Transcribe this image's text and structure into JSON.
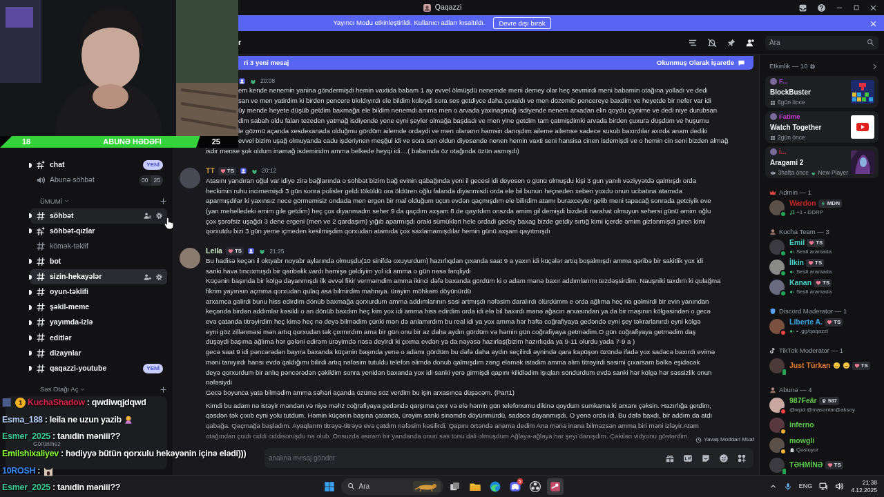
{
  "window": {
    "title": "Qaqazzi"
  },
  "banner": {
    "text": "Yayıncı Modu etkinleştirildi. Kullanıcı adları kısaltıldı.",
    "button": "Devre dışı bırak"
  },
  "goal_bar": {
    "current": "18",
    "label": "ABUNƏ HƏDƏFI",
    "target": "25",
    "level": 0.84
  },
  "sidebar": {
    "items": [
      {
        "kind": "special",
        "name": "chat",
        "unread": true,
        "selected": false,
        "hovered": false,
        "badge": "YENİ"
      },
      {
        "kind": "voice",
        "name": "Abunə söhbət",
        "unread": false,
        "selected": false,
        "hovered": false,
        "counts": [
          "00",
          "25"
        ]
      },
      {
        "kind": "category",
        "name": "ÜMUMİ"
      },
      {
        "kind": "text",
        "name": "söhbət",
        "unread": true,
        "selected": false,
        "hovered": true
      },
      {
        "kind": "special",
        "name": "söhbət-qızlar",
        "unread": true,
        "selected": false,
        "hovered": false
      },
      {
        "kind": "text",
        "name": "kömək-təklif",
        "unread": false,
        "selected": false,
        "hovered": false
      },
      {
        "kind": "text",
        "name": "bot",
        "unread": true,
        "selected": false,
        "hovered": false
      },
      {
        "kind": "text",
        "name": "sizin-hekayələr",
        "unread": true,
        "selected": true,
        "hovered": false
      },
      {
        "kind": "text",
        "name": "oyun-təklifi",
        "unread": true,
        "selected": false,
        "hovered": false
      },
      {
        "kind": "text",
        "name": "şəkil-meme",
        "unread": true,
        "selected": false,
        "hovered": false
      },
      {
        "kind": "text",
        "name": "yayımda-izlə",
        "unread": true,
        "selected": false,
        "hovered": false
      },
      {
        "kind": "text",
        "name": "editlər",
        "unread": true,
        "selected": false,
        "hovered": false
      },
      {
        "kind": "text",
        "name": "dizaynlar",
        "unread": true,
        "selected": false,
        "hovered": false
      },
      {
        "kind": "text",
        "name": "qaqazzi-youtube",
        "unread": true,
        "selected": false,
        "hovered": false,
        "badge": "YENİ"
      },
      {
        "kind": "category",
        "name": "Səs Otağı Aç"
      }
    ],
    "user_status": "Görünmez"
  },
  "channel_header": {
    "name": "r",
    "search_placeholder": "Ara"
  },
  "new_messages": {
    "text": "ri 3 yeni mesaj",
    "action": "Okunmuş Olarak İşaretle"
  },
  "messages": [
    {
      "time": "20:08",
      "lines": [
        "em kende nenemin yanina göndermişdi hemin vaxtida babam 1 ay evvel ölmüşdü nenemde meni demey olar heç sevmirdi meni babamin otağına yolladı ve dedi",
        "san ve men yatirdim ki birden pencere tıkıldıyırdı ele bildim küleydi  sora ses getdiyce daha çoxaldı ve men dözemib pencereye baxdim ve heyetde bir nefer var idi",
        "üy mende heyete düşüb getdim baxmağa ele bildim nenemdi amma men o arvada yaxinaşmağ isdiyende nenem arxadan elin qoydu çiynime ve dedi niye durubsan",
        "dim sabah oldu falan tezeden yatmağ isdiyende yene eyni şeyler olmağa başdadı ve men yine getdim tam çatmişdimki arvada birden çuxura düşdüm ve huşumu",
        "le gözmü açanda xesdexanada olduğmu gördüm ailemde ordaydi ve men olanarın hamsin danışdım aileme ailemse sadece susub baxırdılar axırda anam dediki",
        "evvel bizim uşağ olmuyanda cadu işderiynen meşğul idi ve sora sen oldun diyesende nenen hemin vaxti seni hansisa cinen isdemişdi ve o hemin cin seni bizden almağ",
        "isdir  mense şok oldum inamağ isdemiridm amma belkede heyqi idi....( babamda öz otağında özün asmışdı)"
      ]
    },
    {
      "author": "TT",
      "color": "#c99a3c",
      "tag": "TS",
      "time": "20:12",
      "lines": [
        "Atasını yandıran oğul var idiye zirə bağlarında o söhbət bizim bağ evinin qabağında yeni il gecesi idi deyesen o günü olmuşdu kişi 3 gun yanılı vəziyyətdə qalmışdı orda",
        "heckimin ruhu incimemişdi 3 gün sonra polisler geldi töküldü ora öldüren oğlu falanda diyanmisdi orda ele bil bunun heçneden xeberi yoxdu onun ucbatına atamıda",
        "aparmışdılar ki yaxınsız nece görmemisiz ondada men ergen bir mal olduğum üçün evdən qaçmışdım ele bilirdim atamı buraxceyler gelib meni tapacağ sonrada getciyik eve",
        "(yan mehelledeki əmim gile getdim) heç çox diyanmadm seher 9 da qaçdım axşam 8 de qayıtdım onszda əmim gil demişdi bizdedi narahat olmuyun sehersi günü əmim oğlu",
        "çox şərəfsiz uşağdı 3 dene ergeni (men ve 2 qardaşım) yığıb aparmışdı oraki sümükləri hele ordadi gedey baxag bizde getdiy sırtığ kimi içerde əmim gizlənmişdi giren kimi",
        "qorxutdu bizi 3 gün yeme içmeden kesilmişdim qorxudan atamıda çox saxlamamışdılar  hemin günü axşam qayıtmışdı"
      ]
    },
    {
      "author": "Leila",
      "color": "#cfe8c6",
      "tag": "TS",
      "time": "21:25",
      "lines": [
        "Bu hadisə keçən il oktyabr noyabr aylarında olmuşdu(10 sinifdə oxuyurdum) hazırlıqdan çıxanda saat 9 a yaxın idi küçələr artıq boşalmışdı amma qəribə bir sakitlik yox idi",
        "sanki hava tıncıxmışdı bir qəribəlik vardı həmişə gəldiyim yol idi amma o gün nəsə fərqliydi",
        "Küçənin başında bir kölgə dayanmışdı ilk əvvəl fikir verməmdim amma ikinci dəfə baxanda gördüm ki o adam mənə baxır addımlarımı tezdəşsirdim. Nauşniki taxdım ki qulağma",
        "fikrim yayınsın açmma qorxudan qulaq asa bilmirdim mahnıya. ürəyim möhkəm döyünürdü",
        "arxamca gəlirdi bunu hiss edirdim dönüb baxmağa qorxurdum amma addımlarının səsi artmışdı nəfəsim daralırdı ölürdümm e orda ağlıma heç nə gəlmirdi bir evin yanından",
        "keçəndə birdən addımlar kəsildi o an dönüb baxdım heç kim yox idi amma hiss edirdim orda idi elə bil baxırdı mənə ağacın arxasından ya da bir maşının kölgəsindən o gecə",
        "evə çatanda titrəyirdim heç kimə heç nə deyə bilmədim çünki mən də anlamırdım bu real idi ya yox amma hər həftə coğrafiyaya gedəndə eyni şey təkrarlanırdı eyni kölgə",
        "eyni göz zillənməsi mən artıq qorxudan tək çıxmırdım ama bir gün onu bir az daha aydın gördüm və həmin gün coğrafiyaya getmədim.O gün coğrafiyaya getmədim daş",
        "düşəydi başıma ağlıma hər gələni edirəm ürəyimdə nəsə deyirdi ki çıxma evdən ya da nəyəsə hazırlaş(bizim hazırlıqda ya 9-11 olurdu yada 7-9 a )",
        "gecə saat 9 idi pəncərədən bayıra baxanda küçənin başında yenə o adamı gördüm bu dəfə daha aydın seçilirdi əynində qara kapüşon üzündə ifadə yox sadəcə baxırdı evimə",
        "məni tanıyırdı hansı evdə qaldığımı bilirdi artıq nəfəsim tutuldu telefon əlimdə donub qalmışdım zəng eləmək istədim amma əlim titrəyirdi səsimi çıxarsam bəlkə eşidəcək",
        "deyə qorxurdum bir anlıq pəncərədən çəkildim sonra yenidən baxanda yox idi sanki yerə girmişdi qapını kilidlədim işıqları söndürdüm evdə sanki hər kölgə hər səssizlik onun",
        "nəfəsiydi",
        "Gecə boyunca yata bilmədim amma səhəri açanda özümə söz verdim bu işin arxasınca düşəcəm. (Part1)"
      ]
    },
    {
      "lines": [
        "Kimdi bu adam nə istəyir məndən və niyə məhz coğrafiyaya gedəndə qarşıma çıxır və elə həmin gün telefonumu dikinə qoydum sumkama ki arxanı çəksin.  Hazırlığa getdim,",
        "qəsdən tək çıxıb eyni yolu tutdum. Həmin küçənin başına çatanda, ürəyim sanki sinəmdə döyünmürdü, sadəcə dayanmışdı. O yenə orda idi. Bu dəfə baxdı, bir addım da atdı",
        "qabağa. Qaçmağa başladım. Ayaqlarım titrəyə-titrəyə evə çatdım nəfəsim kəsilirdi. Qapını örtəndə anama dedim Ana mənə inana bilməzsən amma biri məni izləyir.Atam",
        "otağından çıxdı ciddi ciddisoruşdu nə olub. Onsuzda əsirəm bir yandanda onun səs tonu dəli olmuşdum Ağlaya-ağlaya hər şeyi danışdım. Çəkilən vidyonu göstərdim."
      ]
    }
  ],
  "slowmode_note": "Yavaş Moddan Muaf",
  "composer": {
    "placeholder": "analına mesaj gönder"
  },
  "activity": {
    "title": "Etkinlik — 10",
    "cards": [
      {
        "kind": "blocks",
        "user": "F...",
        "color": "#b04ae0",
        "game": "BlockBuster",
        "time": "6gün önce"
      },
      {
        "kind": "video",
        "user": "Fatime",
        "color": "#c93ad6",
        "game": "Watch Together",
        "time": "2gün önce"
      },
      {
        "kind": "art",
        "user": "İ...",
        "color": "#d0344e",
        "game": "Aragami 2",
        "time": "3hafta önce",
        "extra": "New Player"
      }
    ]
  },
  "member_groups": [
    {
      "title": "Admin — 1",
      "members": [
        {
          "name": "Wardon",
          "color": "#c0262c",
          "status": {
            "kind": "dot",
            "color": "#23a55a"
          },
          "tag": {
            "kind": "bolt",
            "text": "MDN"
          },
          "activity": {
            "kind": "note",
            "text": "+1 • DDRP"
          }
        }
      ]
    },
    {
      "title": "Kucha Team — 3",
      "members": [
        {
          "name": "Emil",
          "color": "#48d3c6",
          "status": {
            "kind": "dot",
            "color": "#23a55a"
          },
          "tag": {
            "kind": "heart",
            "text": "TS"
          },
          "activity": {
            "kind": "speaker",
            "text": "Sesli aramada"
          }
        },
        {
          "name": "İlkin",
          "color": "#48d3c6",
          "status": {
            "kind": "dot",
            "color": "#23a55a"
          },
          "tag": {
            "kind": "heart",
            "text": "TS"
          },
          "activity": {
            "kind": "speaker",
            "text": "Sesli aramada"
          }
        },
        {
          "name": "Kanan",
          "color": "#48d3c6",
          "status": {
            "kind": "dot",
            "color": "#23a55a"
          },
          "tag": {
            "kind": "heart",
            "text": "TS"
          },
          "activity": {
            "kind": "speaker",
            "text": "Sesli aramada"
          }
        }
      ]
    },
    {
      "title": "Discord Moderator — 1",
      "members": [
        {
          "name": "Liberte A.",
          "color": "#3aa8e8",
          "status": {
            "kind": "dot",
            "color": "#f23f43"
          },
          "tag": {
            "kind": "heart",
            "text": "TS"
          },
          "activity": {
            "kind": "speaker",
            "text": "• .gg/qaqazzi"
          }
        }
      ]
    },
    {
      "title": "TikTok Moderator — 1",
      "members": [
        {
          "name": "Just Türkan",
          "color": "#e07a30",
          "status": {
            "kind": "mobile",
            "color": "#23a55a"
          },
          "tag": {
            "kind": "heart",
            "text": "TS"
          }
        }
      ]
    },
    {
      "title": "Abunə — 4",
      "members": [
        {
          "name": "987Feâr",
          "color": "#5ec94a",
          "status": {
            "kind": "dot",
            "color": "#f23f43"
          },
          "tag": {
            "kind": "paw",
            "text": "987"
          },
          "activity": {
            "kind": "none",
            "text": "@wpd @masonlar@aksoy"
          }
        },
        {
          "name": "inferno",
          "color": "#5ec94a",
          "status": {
            "kind": "dot",
            "color": "#f0b232"
          }
        },
        {
          "name": "mowgli",
          "color": "#5ec94a",
          "status": {
            "kind": "dot",
            "color": "#f0b232"
          },
          "activity": {
            "kind": "ghost",
            "text": "Qosluyur"
          }
        },
        {
          "name": "TƏHMİNƏ",
          "color": "#5ec94a",
          "status": {
            "kind": "mobile",
            "color": "#23a55a"
          },
          "tag": {
            "kind": "heart",
            "text": "TS"
          }
        }
      ]
    }
  ],
  "stream_chat": [
    {
      "kind": "text",
      "user": "KuchaShadow",
      "color": "#d92550",
      "badge": "1",
      "text": ": qwdiwqjdqwd"
    },
    {
      "kind": "text-emoji",
      "user": "Esma_188",
      "color": "#b9d3ff",
      "text": ": leila ne uzun yazib"
    },
    {
      "kind": "text",
      "user": "Esmer_2025",
      "color": "#3fcf9b",
      "text": ": tanıdin məniii??"
    },
    {
      "kind": "text",
      "user": "Emilshixaliyev",
      "color": "#8dff3a",
      "text": ": hədiyyə bütün qorxulu hekəyənin içinə elədi)))"
    },
    {
      "user": "10ROSH",
      "color": "#3b8cff",
      "text": ":"
    },
    {
      "kind": "text",
      "user": "Esmer_2025",
      "color": "#3fcf9b",
      "text": ": tanıdin məniii??"
    }
  ],
  "taskbar": {
    "search": "Ara",
    "apps": [
      {
        "kind": "start",
        "active": false
      },
      {
        "kind": "taskview",
        "active": false
      },
      {
        "kind": "folder",
        "active": false
      },
      {
        "kind": "browser",
        "active": false
      },
      {
        "kind": "chat",
        "active": false,
        "badge": "5"
      },
      {
        "kind": "recorder",
        "active": false
      },
      {
        "kind": "game",
        "active": true
      }
    ],
    "language": "ENG",
    "time": "21:38",
    "date": "4.12.2025"
  }
}
